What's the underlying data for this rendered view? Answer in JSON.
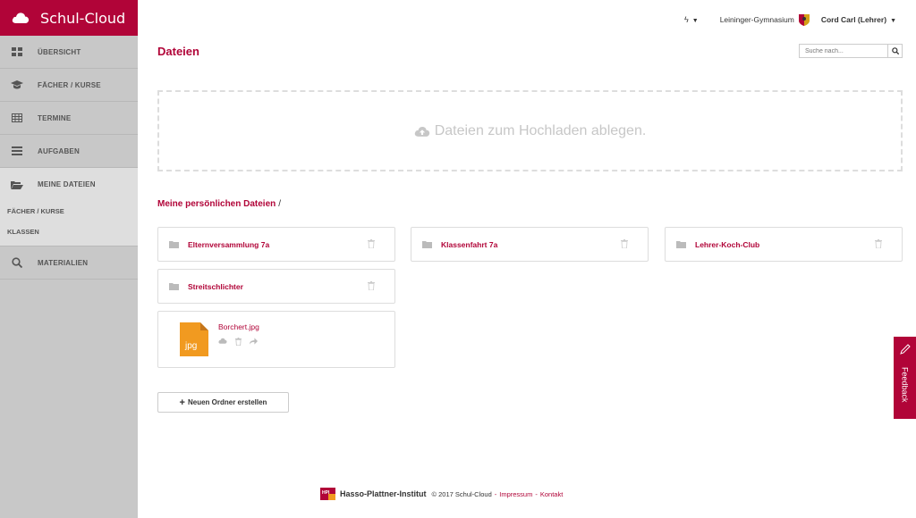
{
  "app": {
    "title": "Schul-Cloud"
  },
  "sidebar": {
    "items": [
      {
        "label": "ÜBERSICHT"
      },
      {
        "label": "FÄCHER / KURSE"
      },
      {
        "label": "TERMINE"
      },
      {
        "label": "AUFGABEN"
      },
      {
        "label": "MEINE DATEIEN"
      },
      {
        "label": "MATERIALIEN"
      }
    ],
    "sub_items": [
      {
        "label": "FÄCHER / KURSE"
      },
      {
        "label": "KLASSEN"
      }
    ]
  },
  "topbar": {
    "school": "Leininger-Gymnasium",
    "user": "Cord Carl (Lehrer)"
  },
  "page": {
    "title": "Dateien",
    "search_placeholder": "Suche nach...",
    "dropzone_text": "Dateien zum Hochladen ablegen.",
    "breadcrumb_link": "Meine persönlichen Dateien",
    "breadcrumb_sep": "/",
    "folders": [
      {
        "name": "Elternversammlung 7a"
      },
      {
        "name": "Klassenfahrt 7a"
      },
      {
        "name": "Lehrer-Koch-Club"
      },
      {
        "name": "Streitschlichter"
      }
    ],
    "files": [
      {
        "name": "Borchert.jpg",
        "type": "jpg"
      }
    ],
    "new_folder_label": "Neuen Ordner erstellen"
  },
  "footer": {
    "logo_text": "HPI",
    "institute": "Hasso-Plattner-Institut",
    "copyright": "© 2017 Schul-Cloud",
    "impressum": "Impressum",
    "kontakt": "Kontakt",
    "separator": "-"
  },
  "feedback": {
    "label": "Feedback"
  },
  "colors": {
    "accent": "#b10438",
    "sidebar": "#c8c8c8",
    "sidebar_active": "#dedede",
    "file_jpg": "#f19a20"
  }
}
